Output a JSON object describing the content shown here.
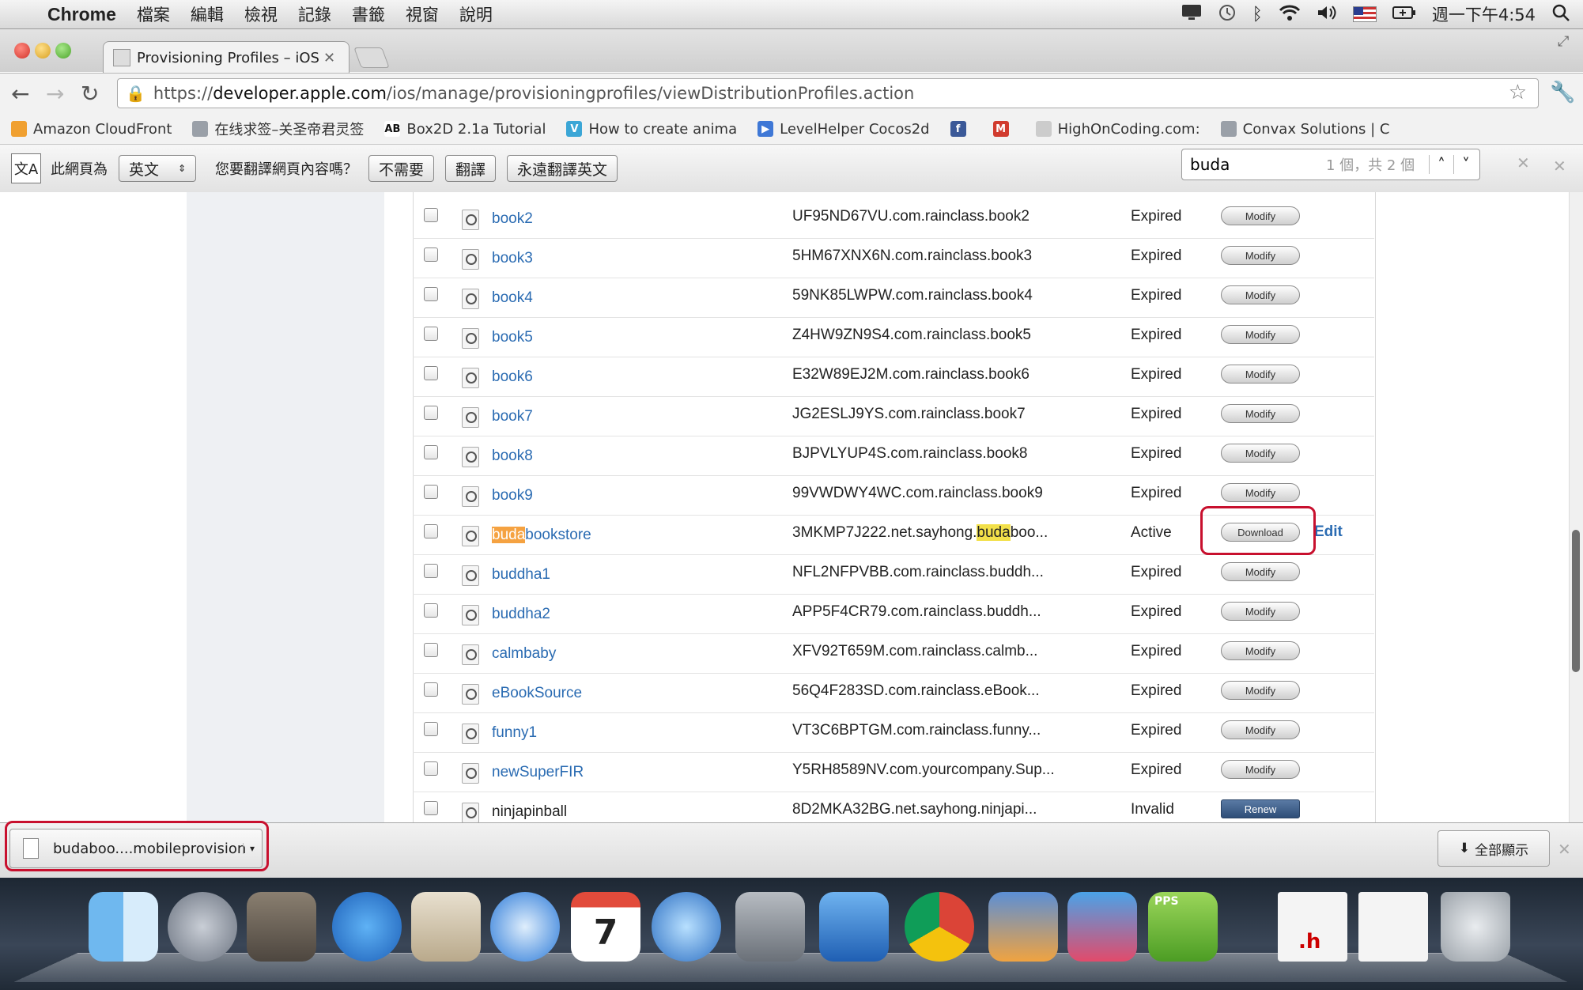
{
  "menubar": {
    "app_name": "Chrome",
    "menus": [
      "檔案",
      "編輯",
      "檢視",
      "記錄",
      "書籤",
      "視窗",
      "說明"
    ],
    "clock": "週一下午4:54"
  },
  "browser": {
    "tab_title": "Provisioning Profiles – iOS Pr",
    "url_scheme": "https://",
    "url_host": "developer.apple.com",
    "url_path": "/ios/manage/provisioningprofiles/viewDistributionProfiles.action",
    "bookmarks": [
      {
        "label": "Amazon CloudFront",
        "color": "#f0a030",
        "glyph": ""
      },
      {
        "label": "在线求签–关圣帝君灵签",
        "color": "#9aa0a8",
        "glyph": ""
      },
      {
        "label": "Box2D 2.1a Tutorial",
        "color": "#ffffff",
        "glyph": "AB"
      },
      {
        "label": "How to create anima",
        "color": "#3ba6d6",
        "glyph": "V"
      },
      {
        "label": "LevelHelper Cocos2d",
        "color": "#3f78d6",
        "glyph": "▶"
      },
      {
        "label": "",
        "color": "#3b5998",
        "glyph": "f"
      },
      {
        "label": "",
        "color": "#d13b2e",
        "glyph": "M"
      },
      {
        "label": "HighOnCoding.com:",
        "color": "#cccccc",
        "glyph": ""
      },
      {
        "label": "Convax Solutions | C",
        "color": "#9aa0a8",
        "glyph": ""
      }
    ]
  },
  "translate_bar": {
    "prefix": "此網頁為",
    "language": "英文",
    "question": "您要翻譯網頁內容嗎？",
    "no_label": "不需要",
    "translate_label": "翻譯",
    "always_label": "永遠翻譯英文"
  },
  "find": {
    "query": "buda",
    "count": "1 個，共 2 個"
  },
  "profiles": [
    {
      "name": "book2",
      "app_id": "UF95ND67VU.com.rainclass.book2",
      "status": "Expired",
      "action": "Modify"
    },
    {
      "name": "book3",
      "app_id": "5HM67XNX6N.com.rainclass.book3",
      "status": "Expired",
      "action": "Modify"
    },
    {
      "name": "book4",
      "app_id": "59NK85LWPW.com.rainclass.book4",
      "status": "Expired",
      "action": "Modify"
    },
    {
      "name": "book5",
      "app_id": "Z4HW9ZN9S4.com.rainclass.book5",
      "status": "Expired",
      "action": "Modify"
    },
    {
      "name": "book6",
      "app_id": "E32W89EJ2M.com.rainclass.book6",
      "status": "Expired",
      "action": "Modify"
    },
    {
      "name": "book7",
      "app_id": "JG2ESLJ9YS.com.rainclass.book7",
      "status": "Expired",
      "action": "Modify"
    },
    {
      "name": "book8",
      "app_id": "BJPVLYUP4S.com.rainclass.book8",
      "status": "Expired",
      "action": "Modify"
    },
    {
      "name": "book9",
      "app_id": "99VWDWY4WC.com.rainclass.book9",
      "status": "Expired",
      "action": "Modify"
    },
    {
      "name": "budabookstore",
      "name_highlight": "buda",
      "name_rest": "bookstore",
      "app_id": "3MKMP7J222.net.sayhong.budaboo...",
      "app_id_pre": "3MKMP7J222.net.sayhong.",
      "app_id_hl": "buda",
      "app_id_post": "boo...",
      "status": "Active",
      "action": "Download",
      "edit": "Edit"
    },
    {
      "name": "buddha1",
      "app_id": "NFL2NFPVBB.com.rainclass.buddh...",
      "status": "Expired",
      "action": "Modify"
    },
    {
      "name": "buddha2",
      "app_id": "APP5F4CR79.com.rainclass.buddh...",
      "status": "Expired",
      "action": "Modify"
    },
    {
      "name": "calmbaby",
      "app_id": "XFV92T659M.com.rainclass.calmb...",
      "status": "Expired",
      "action": "Modify"
    },
    {
      "name": "eBookSource",
      "app_id": "56Q4F283SD.com.rainclass.eBook...",
      "status": "Expired",
      "action": "Modify"
    },
    {
      "name": "funny1",
      "app_id": "VT3C6BPTGM.com.rainclass.funny...",
      "status": "Expired",
      "action": "Modify"
    },
    {
      "name": "newSuperFIR",
      "app_id": "Y5RH8589NV.com.yourcompany.Sup...",
      "status": "Expired",
      "action": "Modify"
    },
    {
      "name": "ninjapinball",
      "app_id": "8D2MKA32BG.net.sayhong.ninjapi...",
      "status": "Invalid",
      "action": "Renew"
    }
  ],
  "download_shelf": {
    "file_name": "budaboo....mobileprovision",
    "show_all": "全部顯示"
  },
  "dock_icons": [
    "finder-icon",
    "launchpad-icon",
    "mission-control-icon",
    "app-store-icon",
    "mail-icon",
    "safari-icon",
    "calendar-icon",
    "itunes-icon",
    "system-preferences-icon",
    "xcode-icon",
    "chrome-icon",
    "app-tiger-icon",
    "app-parrot-icon",
    "pps-icon",
    "header-file-icon",
    "document-icon",
    "trash-icon"
  ],
  "calendar_day": "7",
  "pps_label": "PPS",
  "h_file_label": ".h",
  "colors": {
    "link": "#2a6bb2",
    "highlight_orange": "#f5a241",
    "highlight_yellow": "#f2e04a",
    "annotation_red": "#c8102e"
  }
}
